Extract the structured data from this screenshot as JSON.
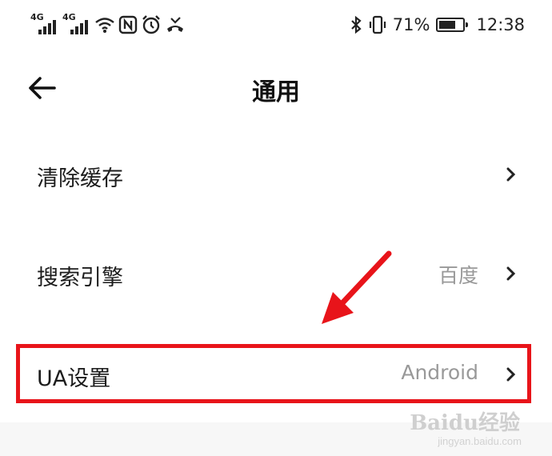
{
  "status_bar": {
    "signal1_tag": "4G",
    "signal2_tag": "4G",
    "icons_left": [
      "signal-4g-icon",
      "signal-4g-icon",
      "wifi-icon",
      "nfc-icon",
      "alarm-icon",
      "missed-call-icon"
    ],
    "icons_right": [
      "bluetooth-icon",
      "vibrate-icon",
      "battery-icon"
    ],
    "battery_percent": "71%",
    "battery_level": 0.71,
    "time": "12:38"
  },
  "nav": {
    "title": "通用"
  },
  "settings": {
    "items": [
      {
        "label": "清除缓存",
        "value": ""
      },
      {
        "label": "搜索引擎",
        "value": "百度"
      },
      {
        "label": "UA设置",
        "value": "Android"
      }
    ]
  },
  "annotation": {
    "highlight_color": "#e8141a"
  },
  "watermark": {
    "text": "Baidu经验",
    "sub": "jingyan.baidu.com"
  }
}
